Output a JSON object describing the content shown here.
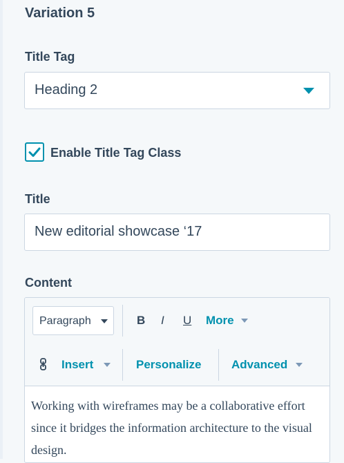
{
  "section": {
    "title": "Variation 5"
  },
  "title_tag": {
    "label": "Title Tag",
    "selected": "Heading 2"
  },
  "enable_class": {
    "label": "Enable Title Tag Class",
    "checked": true
  },
  "title_field": {
    "label": "Title",
    "value": "New editorial showcase ‘17"
  },
  "content": {
    "label": "Content",
    "toolbar": {
      "paragraph": "Paragraph",
      "bold": "B",
      "italic": "I",
      "underline": "U",
      "more": "More",
      "insert": "Insert",
      "personalize": "Personalize",
      "advanced": "Advanced"
    },
    "body": "Working with wireframes may be a collaborative effort since it bridges the information architecture to the visual design."
  },
  "colors": {
    "accent": "#0091ae",
    "text": "#33475b",
    "border": "#cbd6e2",
    "background": "#f5f8fa"
  },
  "icons": {
    "dropdown": "chevron-down-icon",
    "checkbox": "checkmark-icon",
    "insert": "link-icon"
  }
}
